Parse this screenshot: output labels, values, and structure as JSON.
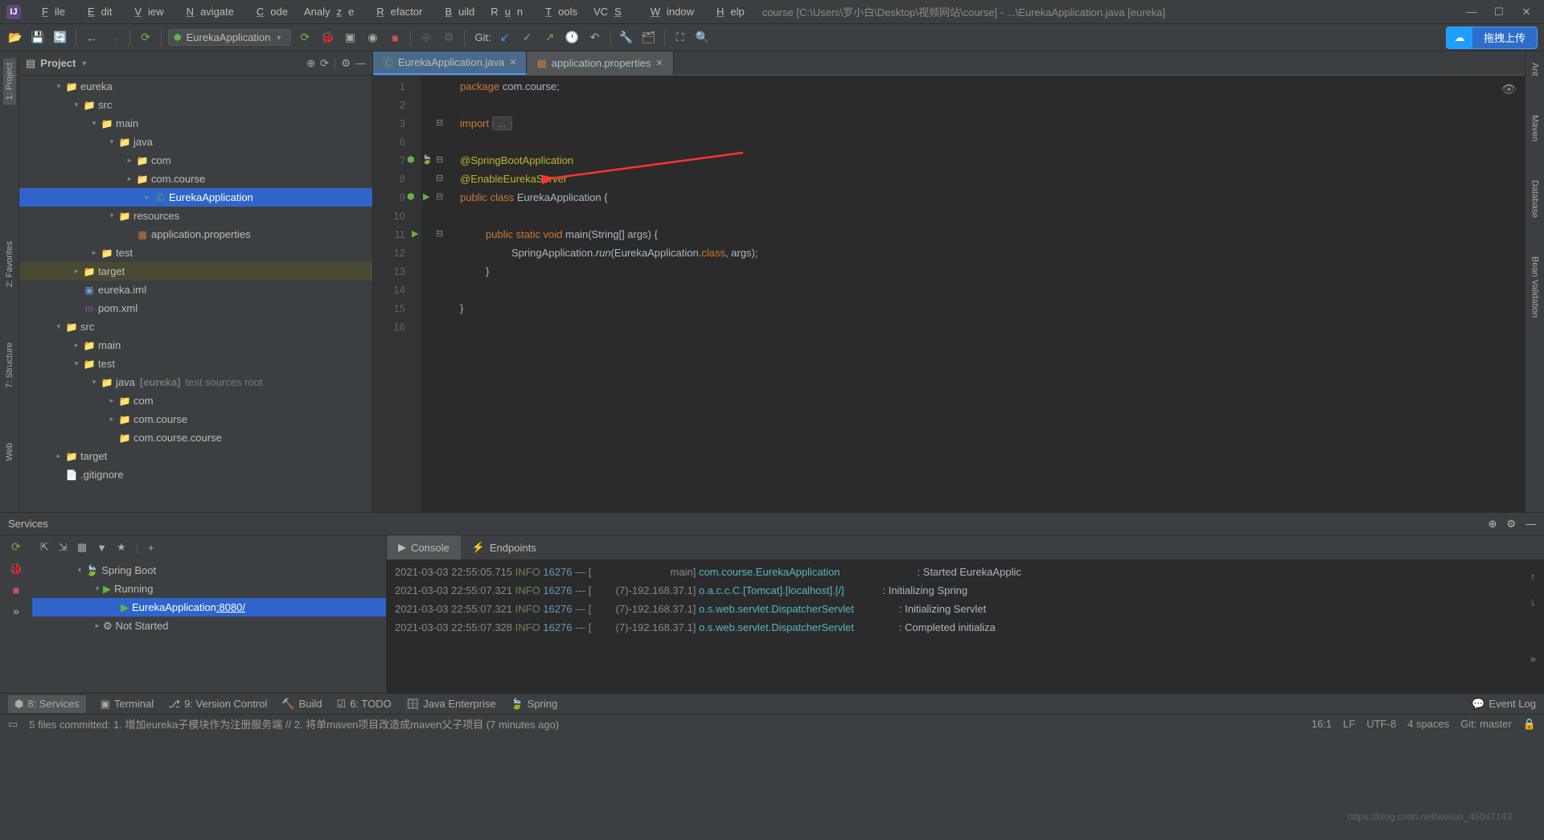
{
  "title": {
    "project": "course",
    "path": "[C:\\Users\\罗小白\\Desktop\\视频网站\\course] - ...\\EurekaApplication.java [eureka]"
  },
  "menus": [
    "File",
    "Edit",
    "View",
    "Navigate",
    "Code",
    "Analyze",
    "Refactor",
    "Build",
    "Run",
    "Tools",
    "VCS",
    "Window",
    "Help"
  ],
  "toolbar": {
    "run_config_label": "EurekaApplication",
    "git_label": "Git:",
    "upload_label": "拖拽上传"
  },
  "left_stripe": [
    "1: Project",
    "2: Favorites",
    "7: Structure",
    "Web"
  ],
  "right_stripe": [
    "Ant",
    "Maven",
    "Database",
    "Bean Validation"
  ],
  "project_panel": {
    "title": "Project"
  },
  "tree": [
    {
      "indent": 1,
      "arrow": "▾",
      "icon": "folder-blue",
      "label": "eureka"
    },
    {
      "indent": 2,
      "arrow": "▾",
      "icon": "folder-blue",
      "label": "src"
    },
    {
      "indent": 3,
      "arrow": "▾",
      "icon": "folder-blue",
      "label": "main"
    },
    {
      "indent": 4,
      "arrow": "▾",
      "icon": "folder-blue",
      "label": "java"
    },
    {
      "indent": 5,
      "arrow": "▸",
      "icon": "folder",
      "label": "com"
    },
    {
      "indent": 5,
      "arrow": "▸",
      "icon": "folder",
      "label": "com.course"
    },
    {
      "indent": 6,
      "arrow": "▸",
      "icon": "class",
      "label": "EurekaApplication",
      "sel": true
    },
    {
      "indent": 4,
      "arrow": "▾",
      "icon": "folder",
      "label": "resources"
    },
    {
      "indent": 5,
      "arrow": "",
      "icon": "prop",
      "label": "application.properties"
    },
    {
      "indent": 3,
      "arrow": "▸",
      "icon": "folder",
      "label": "test"
    },
    {
      "indent": 2,
      "arrow": "▸",
      "icon": "folder-orange",
      "label": "target",
      "hl": true
    },
    {
      "indent": 2,
      "arrow": "",
      "icon": "module",
      "label": "eureka.iml"
    },
    {
      "indent": 2,
      "arrow": "",
      "icon": "xml",
      "label": "pom.xml"
    },
    {
      "indent": 1,
      "arrow": "▾",
      "icon": "folder",
      "label": "src"
    },
    {
      "indent": 2,
      "arrow": "▸",
      "icon": "folder",
      "label": "main"
    },
    {
      "indent": 2,
      "arrow": "▾",
      "icon": "folder",
      "label": "test"
    },
    {
      "indent": 3,
      "arrow": "▾",
      "icon": "folder",
      "label": "java",
      "note": "[eureka]",
      "note2": "test sources root"
    },
    {
      "indent": 4,
      "arrow": "▸",
      "icon": "folder",
      "label": "com"
    },
    {
      "indent": 4,
      "arrow": "▸",
      "icon": "folder",
      "label": "com.course"
    },
    {
      "indent": 4,
      "arrow": "",
      "icon": "folder",
      "label": "com.course.course"
    },
    {
      "indent": 1,
      "arrow": "▸",
      "icon": "folder-orange",
      "label": "target"
    },
    {
      "indent": 1,
      "arrow": "",
      "icon": "file",
      "label": ".gitignore"
    }
  ],
  "editor_tabs": [
    {
      "label": "EurekaApplication.java",
      "active": true,
      "icon": "class"
    },
    {
      "label": "application.properties",
      "active": false,
      "icon": "prop"
    }
  ],
  "code_lines": {
    "l1_kw": "package",
    "l1_pkg": " com.course;",
    "l3_kw": "import ",
    "l3_fold": "...",
    "l7": "@SpringBootApplication",
    "l8": "@EnableEurekaServer",
    "l9a": "public class ",
    "l9b": "EurekaApplication {",
    "l11a": "public static void ",
    "l11b": "main",
    "l11c": "(String[] args) {",
    "l12a": "SpringApplication.",
    "l12b": "run",
    "l12c": "(EurekaApplication.",
    "l12d": "class",
    "l12e": ", args);",
    "l13": "}",
    "l15": "}"
  },
  "line_numbers": [
    "1",
    "2",
    "3",
    "6",
    "7",
    "8",
    "9",
    "10",
    "11",
    "12",
    "13",
    "14",
    "15",
    "16"
  ],
  "services": {
    "title": "Services",
    "tree": [
      {
        "indent": 1,
        "arrow": "▾",
        "icon": "spring",
        "label": "Spring Boot"
      },
      {
        "indent": 2,
        "arrow": "▾",
        "icon": "run",
        "label": "Running"
      },
      {
        "indent": 3,
        "arrow": "",
        "icon": "run",
        "label": "EurekaApplication",
        "port": ":8080/",
        "sel": true
      },
      {
        "indent": 2,
        "arrow": "▸",
        "icon": "stop",
        "label": "Not Started"
      }
    ],
    "console_tabs": [
      "Console",
      "Endpoints"
    ],
    "log": [
      {
        "ts": "2021-03-03 22:55:05.715",
        "lvl": "INFO",
        "pid": "16276",
        "sep": "--- [",
        "thr": "main]",
        "cls": "com.course.EurekaApplication",
        "msg": ": Started EurekaApplic"
      },
      {
        "ts": "2021-03-03 22:55:07.321",
        "lvl": "INFO",
        "pid": "16276",
        "sep": "--- [",
        "thr": "(7)-192.168.37.1]",
        "cls": "o.a.c.c.C.[Tomcat].[localhost].[/]",
        "msg": ": Initializing Spring"
      },
      {
        "ts": "2021-03-03 22:55:07.321",
        "lvl": "INFO",
        "pid": "16276",
        "sep": "--- [",
        "thr": "(7)-192.168.37.1]",
        "cls": "o.s.web.servlet.DispatcherServlet",
        "msg": ": Initializing Servlet"
      },
      {
        "ts": "2021-03-03 22:55:07.328",
        "lvl": "INFO",
        "pid": "16276",
        "sep": "--- [",
        "thr": "(7)-192.168.37.1]",
        "cls": "o.s.web.servlet.DispatcherServlet",
        "msg": ": Completed initializa"
      }
    ]
  },
  "bottom_tabs": {
    "services": "8: Services",
    "terminal": "Terminal",
    "vcs": "9: Version Control",
    "build": "Build",
    "todo": "6: TODO",
    "javaee": "Java Enterprise",
    "spring": "Spring",
    "eventlog": "Event Log"
  },
  "status": {
    "commit_msg": "5 files committed: 1. 增加eureka子模块作为注册服务端 // 2. 将单maven项目改造成maven父子项目 (7 minutes ago)",
    "caret": "16:1",
    "lf": "LF",
    "enc": "UTF-8",
    "indent": "4 spaces",
    "git": "Git: master"
  },
  "watermark": "https://blog.csdn.net/weixin_45047143"
}
